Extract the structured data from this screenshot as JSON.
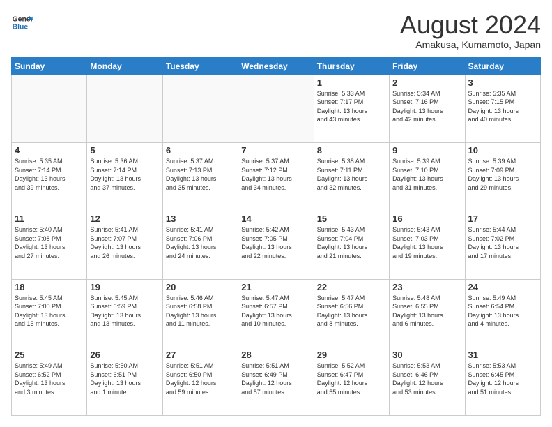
{
  "header": {
    "logo_line1": "General",
    "logo_line2": "Blue",
    "title": "August 2024",
    "subtitle": "Amakusa, Kumamoto, Japan"
  },
  "weekdays": [
    "Sunday",
    "Monday",
    "Tuesday",
    "Wednesday",
    "Thursday",
    "Friday",
    "Saturday"
  ],
  "weeks": [
    [
      {
        "day": "",
        "info": ""
      },
      {
        "day": "",
        "info": ""
      },
      {
        "day": "",
        "info": ""
      },
      {
        "day": "",
        "info": ""
      },
      {
        "day": "1",
        "info": "Sunrise: 5:33 AM\nSunset: 7:17 PM\nDaylight: 13 hours\nand 43 minutes."
      },
      {
        "day": "2",
        "info": "Sunrise: 5:34 AM\nSunset: 7:16 PM\nDaylight: 13 hours\nand 42 minutes."
      },
      {
        "day": "3",
        "info": "Sunrise: 5:35 AM\nSunset: 7:15 PM\nDaylight: 13 hours\nand 40 minutes."
      }
    ],
    [
      {
        "day": "4",
        "info": "Sunrise: 5:35 AM\nSunset: 7:14 PM\nDaylight: 13 hours\nand 39 minutes."
      },
      {
        "day": "5",
        "info": "Sunrise: 5:36 AM\nSunset: 7:14 PM\nDaylight: 13 hours\nand 37 minutes."
      },
      {
        "day": "6",
        "info": "Sunrise: 5:37 AM\nSunset: 7:13 PM\nDaylight: 13 hours\nand 35 minutes."
      },
      {
        "day": "7",
        "info": "Sunrise: 5:37 AM\nSunset: 7:12 PM\nDaylight: 13 hours\nand 34 minutes."
      },
      {
        "day": "8",
        "info": "Sunrise: 5:38 AM\nSunset: 7:11 PM\nDaylight: 13 hours\nand 32 minutes."
      },
      {
        "day": "9",
        "info": "Sunrise: 5:39 AM\nSunset: 7:10 PM\nDaylight: 13 hours\nand 31 minutes."
      },
      {
        "day": "10",
        "info": "Sunrise: 5:39 AM\nSunset: 7:09 PM\nDaylight: 13 hours\nand 29 minutes."
      }
    ],
    [
      {
        "day": "11",
        "info": "Sunrise: 5:40 AM\nSunset: 7:08 PM\nDaylight: 13 hours\nand 27 minutes."
      },
      {
        "day": "12",
        "info": "Sunrise: 5:41 AM\nSunset: 7:07 PM\nDaylight: 13 hours\nand 26 minutes."
      },
      {
        "day": "13",
        "info": "Sunrise: 5:41 AM\nSunset: 7:06 PM\nDaylight: 13 hours\nand 24 minutes."
      },
      {
        "day": "14",
        "info": "Sunrise: 5:42 AM\nSunset: 7:05 PM\nDaylight: 13 hours\nand 22 minutes."
      },
      {
        "day": "15",
        "info": "Sunrise: 5:43 AM\nSunset: 7:04 PM\nDaylight: 13 hours\nand 21 minutes."
      },
      {
        "day": "16",
        "info": "Sunrise: 5:43 AM\nSunset: 7:03 PM\nDaylight: 13 hours\nand 19 minutes."
      },
      {
        "day": "17",
        "info": "Sunrise: 5:44 AM\nSunset: 7:02 PM\nDaylight: 13 hours\nand 17 minutes."
      }
    ],
    [
      {
        "day": "18",
        "info": "Sunrise: 5:45 AM\nSunset: 7:00 PM\nDaylight: 13 hours\nand 15 minutes."
      },
      {
        "day": "19",
        "info": "Sunrise: 5:45 AM\nSunset: 6:59 PM\nDaylight: 13 hours\nand 13 minutes."
      },
      {
        "day": "20",
        "info": "Sunrise: 5:46 AM\nSunset: 6:58 PM\nDaylight: 13 hours\nand 11 minutes."
      },
      {
        "day": "21",
        "info": "Sunrise: 5:47 AM\nSunset: 6:57 PM\nDaylight: 13 hours\nand 10 minutes."
      },
      {
        "day": "22",
        "info": "Sunrise: 5:47 AM\nSunset: 6:56 PM\nDaylight: 13 hours\nand 8 minutes."
      },
      {
        "day": "23",
        "info": "Sunrise: 5:48 AM\nSunset: 6:55 PM\nDaylight: 13 hours\nand 6 minutes."
      },
      {
        "day": "24",
        "info": "Sunrise: 5:49 AM\nSunset: 6:54 PM\nDaylight: 13 hours\nand 4 minutes."
      }
    ],
    [
      {
        "day": "25",
        "info": "Sunrise: 5:49 AM\nSunset: 6:52 PM\nDaylight: 13 hours\nand 3 minutes."
      },
      {
        "day": "26",
        "info": "Sunrise: 5:50 AM\nSunset: 6:51 PM\nDaylight: 13 hours\nand 1 minute."
      },
      {
        "day": "27",
        "info": "Sunrise: 5:51 AM\nSunset: 6:50 PM\nDaylight: 12 hours\nand 59 minutes."
      },
      {
        "day": "28",
        "info": "Sunrise: 5:51 AM\nSunset: 6:49 PM\nDaylight: 12 hours\nand 57 minutes."
      },
      {
        "day": "29",
        "info": "Sunrise: 5:52 AM\nSunset: 6:47 PM\nDaylight: 12 hours\nand 55 minutes."
      },
      {
        "day": "30",
        "info": "Sunrise: 5:53 AM\nSunset: 6:46 PM\nDaylight: 12 hours\nand 53 minutes."
      },
      {
        "day": "31",
        "info": "Sunrise: 5:53 AM\nSunset: 6:45 PM\nDaylight: 12 hours\nand 51 minutes."
      }
    ]
  ]
}
